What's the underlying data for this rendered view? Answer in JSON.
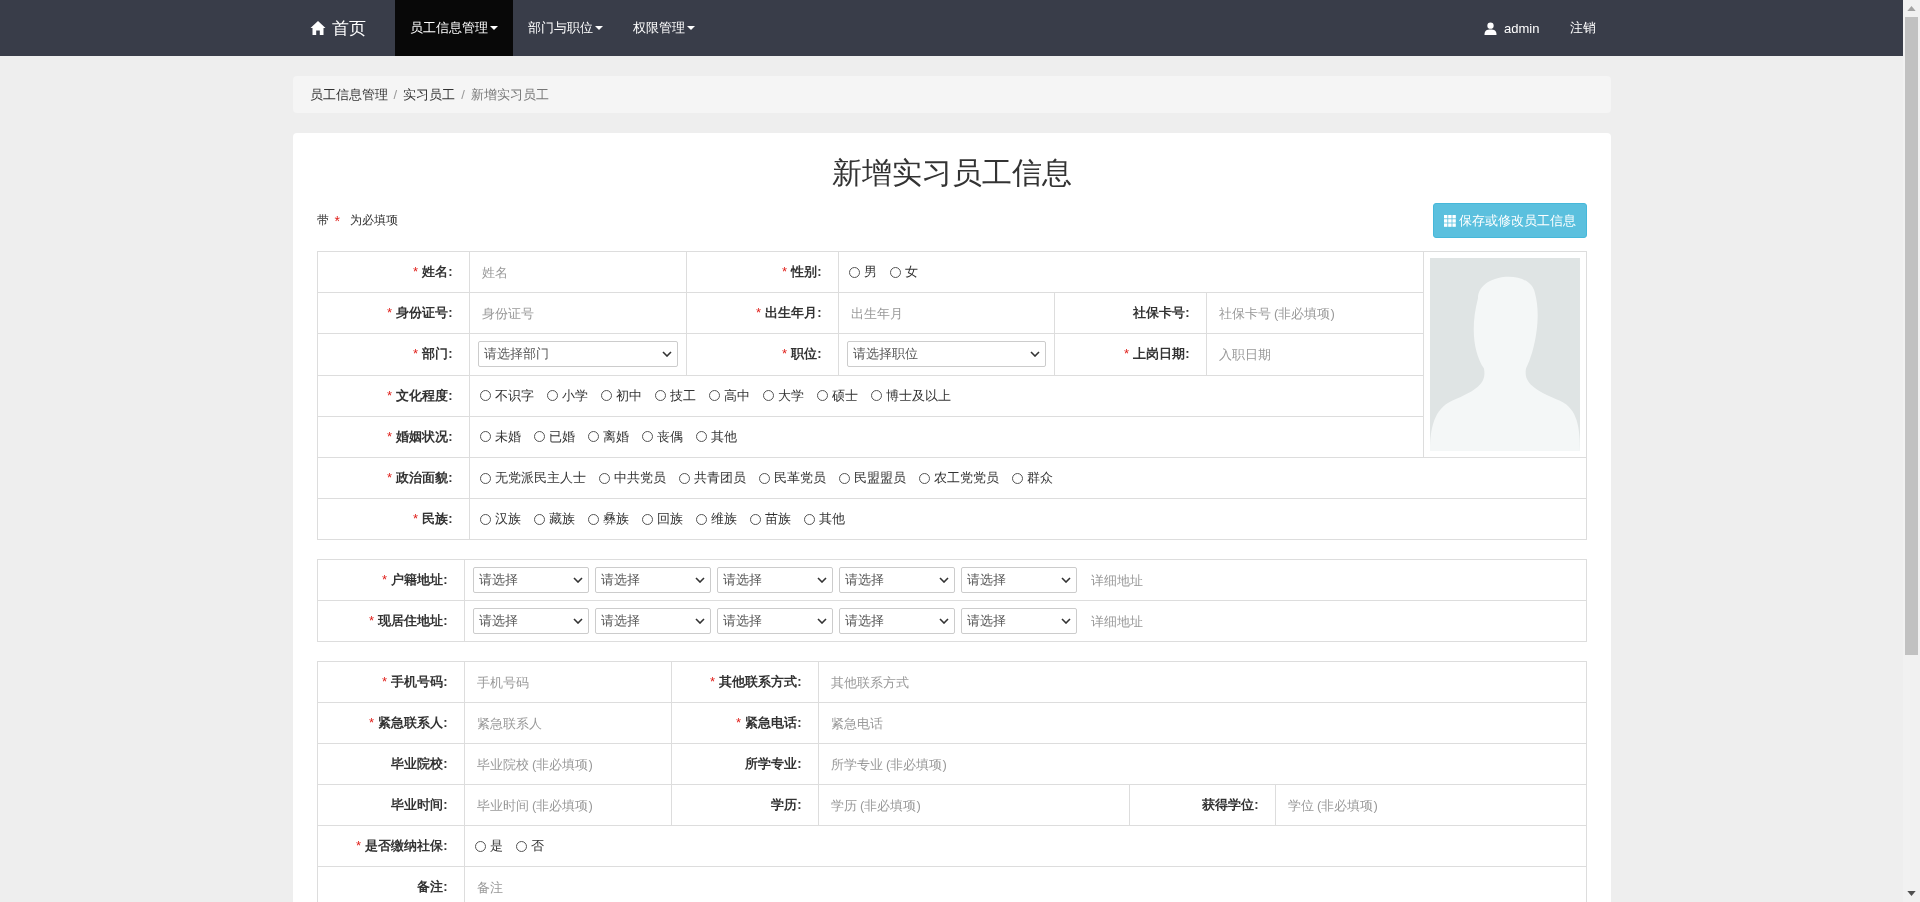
{
  "navbar": {
    "brand": "首页",
    "menus": [
      {
        "label": "员工信息管理",
        "selected": true
      },
      {
        "label": "部门与职位",
        "selected": false
      },
      {
        "label": "权限管理",
        "selected": false
      }
    ],
    "user": "admin",
    "logout": "注销"
  },
  "breadcrumb": [
    {
      "label": "员工信息管理",
      "current": false,
      "separator": "/"
    },
    {
      "label": "实习员工",
      "current": false,
      "separator": "/"
    },
    {
      "label": "新增实习员工",
      "current": true
    }
  ],
  "form": {
    "title": "新增实习员工信息",
    "required_note": {
      "before": "带",
      "mark": "*",
      "after": "为必填项"
    },
    "save_button": "保存或修改员工信息",
    "basic_rows": [
      [
        {
          "label": "姓名:",
          "mark": "*",
          "kind": "text",
          "placeholder": "姓名"
        },
        {
          "label": "性别:",
          "mark": "*",
          "kind": "radio",
          "options": [
            {
              "label": "男",
              "selected": false
            },
            {
              "label": "女",
              "selected": false
            }
          ]
        }
      ],
      [
        {
          "label": "身份证号:",
          "mark": "*",
          "kind": "text",
          "placeholder": "身份证号"
        },
        {
          "label": "出生年月:",
          "mark": "*",
          "kind": "text",
          "placeholder": "出生年月"
        },
        {
          "label": "社保卡号:",
          "kind": "text",
          "placeholder": "社保卡号 (非必填项)"
        }
      ],
      [
        {
          "label": "部门:",
          "mark": "*",
          "kind": "select",
          "placeholder": "请选择部门"
        },
        {
          "label": "职位:",
          "mark": "*",
          "kind": "select",
          "placeholder": "请选择职位"
        },
        {
          "label": "上岗日期:",
          "mark": "*",
          "kind": "text",
          "placeholder": "入职日期"
        }
      ],
      [
        {
          "label": "文化程度:",
          "mark": "*",
          "kind": "radio",
          "options": [
            {
              "label": "不识字",
              "selected": false
            },
            {
              "label": "小学",
              "selected": false
            },
            {
              "label": "初中",
              "selected": false
            },
            {
              "label": "技工",
              "selected": false
            },
            {
              "label": "高中",
              "selected": false
            },
            {
              "label": "大学",
              "selected": false
            },
            {
              "label": "硕士",
              "selected": false
            },
            {
              "label": "博士及以上",
              "selected": false
            }
          ]
        }
      ],
      [
        {
          "label": "婚姻状况:",
          "mark": "*",
          "kind": "radio",
          "options": [
            {
              "label": "未婚",
              "selected": false
            },
            {
              "label": "已婚",
              "selected": false
            },
            {
              "label": "离婚",
              "selected": false
            },
            {
              "label": "丧偶",
              "selected": false
            },
            {
              "label": "其他",
              "selected": false
            }
          ]
        }
      ],
      [
        {
          "label": "政治面貌:",
          "mark": "*",
          "kind": "radio",
          "options": [
            {
              "label": "无党派民主人士",
              "selected": false
            },
            {
              "label": "中共党员",
              "selected": false
            },
            {
              "label": "共青团员",
              "selected": false
            },
            {
              "label": "民革党员",
              "selected": false
            },
            {
              "label": "民盟盟员",
              "selected": false
            },
            {
              "label": "农工党党员",
              "selected": false
            },
            {
              "label": "群众",
              "selected": false
            }
          ]
        }
      ],
      [
        {
          "label": "民族:",
          "mark": "*",
          "kind": "radio",
          "options": [
            {
              "label": "汉族",
              "selected": false
            },
            {
              "label": "藏族",
              "selected": false
            },
            {
              "label": "彝族",
              "selected": false
            },
            {
              "label": "回族",
              "selected": false
            },
            {
              "label": "维族",
              "selected": false
            },
            {
              "label": "苗族",
              "selected": false
            },
            {
              "label": "其他",
              "selected": false
            }
          ]
        }
      ]
    ],
    "address_rows": [
      {
        "label": "户籍地址:",
        "mark": "*",
        "selects": [
          "请选择",
          "请选择",
          "请选择",
          "请选择",
          "请选择"
        ],
        "detail_placeholder": "详细地址"
      },
      {
        "label": "现居住地址:",
        "mark": "*",
        "selects": [
          "请选择",
          "请选择",
          "请选择",
          "请选择",
          "请选择"
        ],
        "detail_placeholder": "详细地址"
      }
    ],
    "contact_rows": [
      [
        {
          "label": "手机号码:",
          "mark": "*",
          "kind": "text",
          "placeholder": "手机号码"
        },
        {
          "label": "其他联系方式:",
          "mark": "*",
          "kind": "text",
          "placeholder": "其他联系方式"
        }
      ],
      [
        {
          "label": "紧急联系人:",
          "mark": "*",
          "kind": "text",
          "placeholder": "紧急联系人"
        },
        {
          "label": "紧急电话:",
          "mark": "*",
          "kind": "text",
          "placeholder": "紧急电话"
        }
      ],
      [
        {
          "label": "毕业院校:",
          "kind": "text",
          "placeholder": "毕业院校 (非必填项)"
        },
        {
          "label": "所学专业:",
          "kind": "text",
          "placeholder": "所学专业 (非必填项)"
        }
      ],
      [
        {
          "label": "毕业时间:",
          "kind": "text",
          "placeholder": "毕业时间 (非必填项)"
        },
        {
          "label": "学历:",
          "kind": "text",
          "placeholder": "学历 (非必填项)"
        },
        {
          "label": "获得学位:",
          "kind": "text",
          "placeholder": "学位 (非必填项)"
        }
      ],
      [
        {
          "label": "是否缴纳社保:",
          "mark": "*",
          "kind": "radio",
          "options": [
            {
              "label": "是",
              "selected": false
            },
            {
              "label": "否",
              "selected": false
            }
          ]
        }
      ],
      [
        {
          "label": "备注:",
          "kind": "text",
          "placeholder": "备注"
        }
      ]
    ]
  }
}
